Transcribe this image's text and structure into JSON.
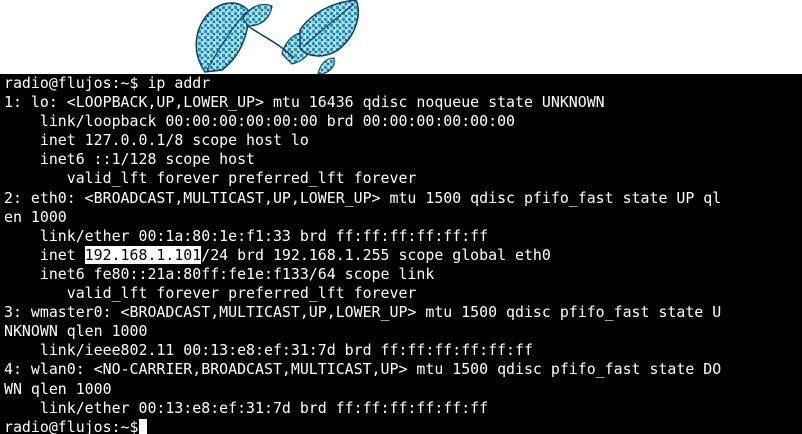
{
  "desktop": {
    "wallpaper": "leaf-illustration",
    "accent_color": "#7fd6e6"
  },
  "terminal": {
    "background": "#000000",
    "foreground": "#ffffff",
    "prompt": "radio@flujos:~$",
    "command": "ip addr",
    "lines": [
      "1: lo: <LOOPBACK,UP,LOWER_UP> mtu 16436 qdisc noqueue state UNKNOWN",
      "    link/loopback 00:00:00:00:00:00 brd 00:00:00:00:00:00",
      "    inet 127.0.0.1/8 scope host lo",
      "    inet6 ::1/128 scope host",
      "       valid_lft forever preferred_lft forever",
      "2: eth0: <BROADCAST,MULTICAST,UP,LOWER_UP> mtu 1500 qdisc pfifo_fast state UP ql",
      "en 1000",
      "    link/ether 00:1a:80:1e:f1:33 brd ff:ff:ff:ff:ff:ff"
    ],
    "highlight_line": {
      "before": "    inet ",
      "selected": "192.168.1.101",
      "after": "/24 brd 192.168.1.255 scope global eth0"
    },
    "lines_after": [
      "    inet6 fe80::21a:80ff:fe1e:f133/64 scope link",
      "       valid_lft forever preferred_lft forever",
      "3: wmaster0: <BROADCAST,MULTICAST,UP,LOWER_UP> mtu 1500 qdisc pfifo_fast state U",
      "NKNOWN qlen 1000",
      "    link/ieee802.11 00:13:e8:ef:31:7d brd ff:ff:ff:ff:ff:ff",
      "4: wlan0: <NO-CARRIER,BROADCAST,MULTICAST,UP> mtu 1500 qdisc pfifo_fast state DO",
      "WN qlen 1000",
      "    link/ether 00:13:e8:ef:31:7d brd ff:ff:ff:ff:ff:ff"
    ],
    "final_prompt": "radio@flujos:~$"
  }
}
